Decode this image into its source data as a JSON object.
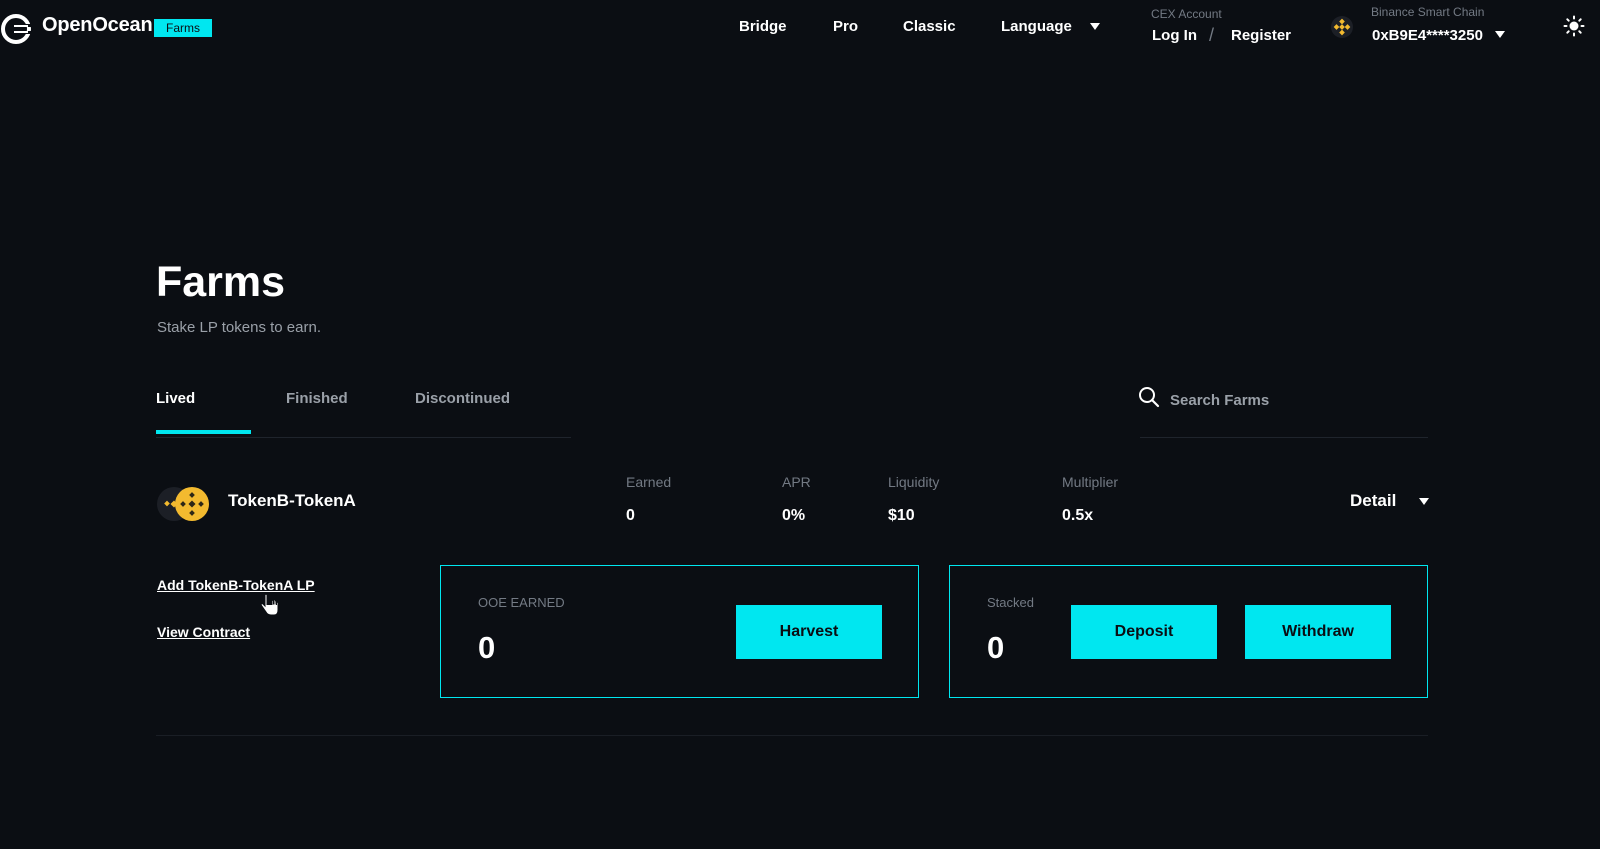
{
  "header": {
    "logo_text": "OpenOcean",
    "badge": "Farms",
    "nav": [
      {
        "label": "Bridge"
      },
      {
        "label": "Pro"
      },
      {
        "label": "Classic"
      },
      {
        "label": "Language"
      }
    ],
    "cex": {
      "label": "CEX Account",
      "login": "Log In",
      "separator": "/",
      "register": "Register"
    },
    "wallet": {
      "chain": "Binance Smart Chain",
      "address": "0xB9E4****3250"
    }
  },
  "page": {
    "title": "Farms",
    "subtitle": "Stake LP tokens to earn."
  },
  "tabs": [
    {
      "label": "Lived",
      "active": true
    },
    {
      "label": "Finished",
      "active": false
    },
    {
      "label": "Discontinued",
      "active": false
    }
  ],
  "search": {
    "placeholder": "Search Farms",
    "value": ""
  },
  "farm": {
    "pair": "TokenB-TokenA",
    "stats": [
      {
        "label": "Earned",
        "value": "0"
      },
      {
        "label": "APR",
        "value": "0%"
      },
      {
        "label": "Liquidity",
        "value": "$10"
      },
      {
        "label": "Multiplier",
        "value": "0.5x"
      }
    ],
    "detail": "Detail",
    "links": {
      "add_lp": "Add TokenB-TokenA LP",
      "view_contract": "View Contract"
    },
    "earned_panel": {
      "label": "OOE EARNED",
      "value": "0",
      "button": "Harvest"
    },
    "staked_panel": {
      "label": "Stacked",
      "value": "0",
      "deposit": "Deposit",
      "withdraw": "Withdraw"
    }
  },
  "colors": {
    "background": "#0b0e13",
    "accent": "#00e7f0",
    "muted_text": "#9aa0a8",
    "bnb_yellow": "#f3ba2f"
  },
  "icons": [
    "openocean-logo-icon",
    "bnb-chain-icon",
    "sun-theme-icon",
    "search-icon",
    "token-pair-icon",
    "hand-cursor-icon"
  ]
}
